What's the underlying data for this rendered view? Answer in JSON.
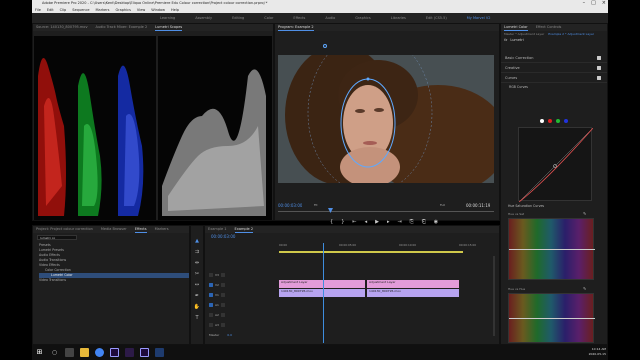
{
  "window": {
    "title": "Adobe Premiere Pro 2020 - C:\\Users\\Kent\\Desktop\\Eliquo Online\\Premiere Edu Colour correction\\Project colour correction.prproj *"
  },
  "menu": [
    "File",
    "Edit",
    "Clip",
    "Sequence",
    "Markers",
    "Graphics",
    "View",
    "Window",
    "Help"
  ],
  "workspaces": [
    "Learning",
    "Assembly",
    "Editing",
    "Color",
    "Effects",
    "Audio",
    "Graphics",
    "Libraries",
    "Edit (CS5.5)",
    "My Marvel V2"
  ],
  "active_workspace": "My Marvel V2",
  "scopes": {
    "tabs": [
      "Source: 140130_800795.mov",
      "Audio Track Mixer: Example 2",
      "Lumetri Scopes"
    ],
    "active_tab": "Lumetri Scopes",
    "bottom_labels": [
      "Clamp Signal",
      "8 bit"
    ]
  },
  "program": {
    "title": "Program: Example 2",
    "timecode": "00:00:03:00",
    "fit": "Fit",
    "quality": "Full",
    "duration": "00:00:11:19"
  },
  "lumetri": {
    "tabs": [
      "Lumetri Color",
      "Effect Controls"
    ],
    "source": "Master * Adjustment Layer",
    "target": "Example 2 * Adjustment Layer",
    "fx_label": "fx",
    "fx_name": "Lumetri",
    "sections": [
      "Basic Correction",
      "Creative",
      "Curves"
    ],
    "rgb_curves_label": "RGB Curves",
    "hsl_label": "Hue Saturation Curves",
    "hue_vs_sat": "Hue vs Sat",
    "hue_vs_hue": "Hue vs Hue"
  },
  "effects": {
    "tabs": [
      "Project: Project colour correction",
      "Media Browser",
      "Effects",
      "Markers"
    ],
    "active_tab": "Effects",
    "search": "lumetri co",
    "tree": [
      "Presets",
      "Lumetri Presets",
      "Audio Effects",
      "Audio Transitions",
      "Video Effects",
      "Color Correction",
      "Lumetri Color",
      "Video Transitions"
    ]
  },
  "timeline": {
    "tabs": [
      "Example 1",
      "Example 2"
    ],
    "active_tab": "Example 2",
    "timecode": "00:00:03:00",
    "ruler": [
      "00:00",
      "00:00:05:00",
      "00:00:10:00",
      "00:00:15:00"
    ],
    "tracks": [
      "V3",
      "V2",
      "V1",
      "A1",
      "A2",
      "A3"
    ],
    "master_label": "Master",
    "master_value": "0.0",
    "clips": {
      "v2_a": "Adjustment Layer",
      "v2_b": "Adjustment Layer",
      "v1_a": "140130_800795.mov",
      "v1_b": "140130_800795.mov"
    }
  },
  "taskbar": {
    "time": "10:14 AM",
    "date": "2020-05-15"
  },
  "colors": {
    "accent": "#4f8fe6",
    "clip_pink": "#e29bd9",
    "clip_v1": "#b7a4f0",
    "playhead": "#3e8dde"
  }
}
